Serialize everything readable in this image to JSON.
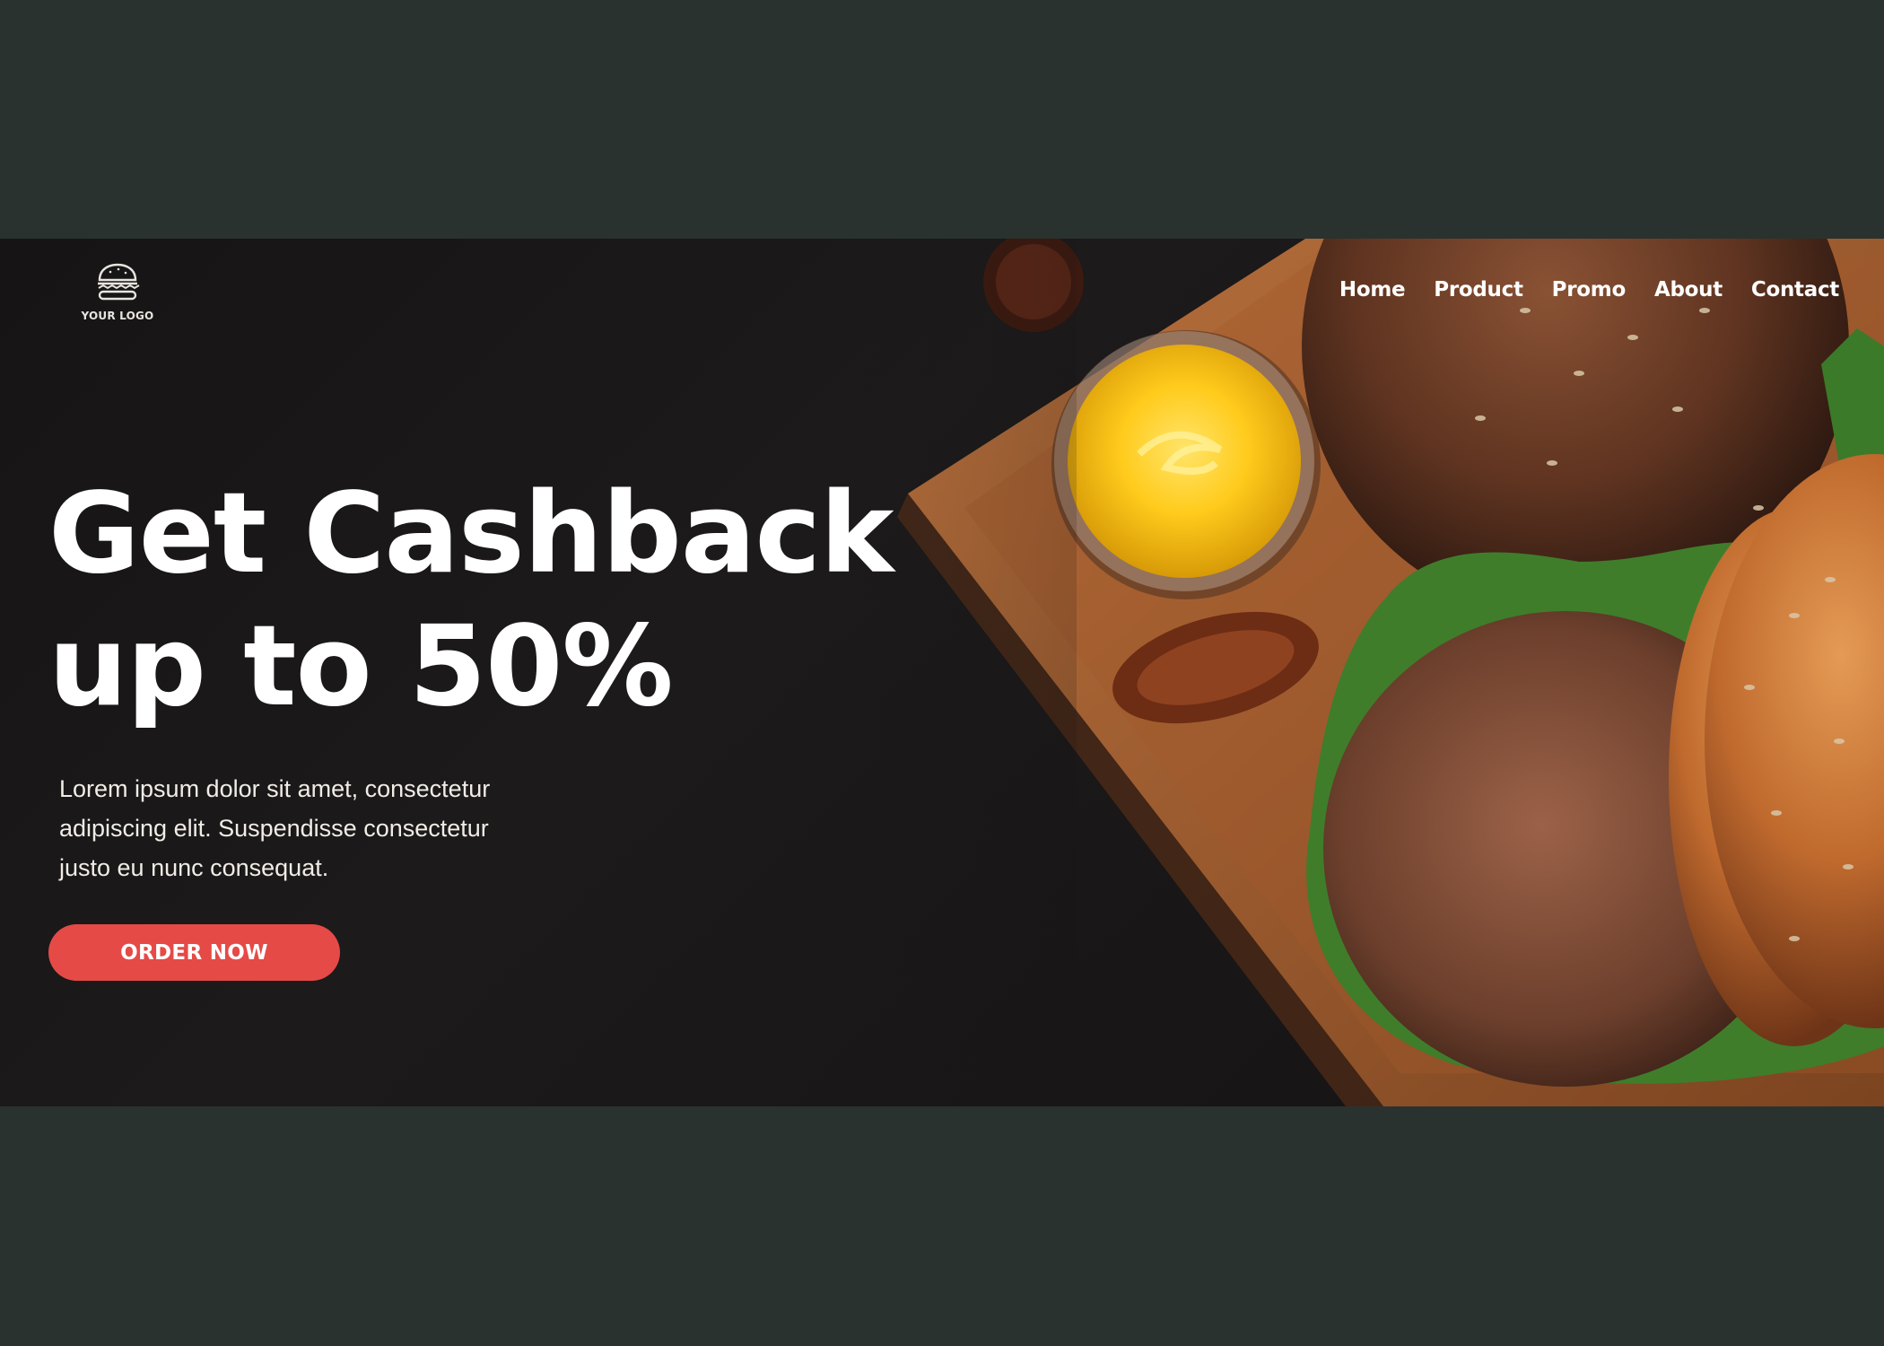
{
  "logo": {
    "text": "YOUR LOGO",
    "icon": "burger-icon"
  },
  "nav": {
    "items": [
      "Home",
      "Product",
      "Promo",
      "About",
      "Contact"
    ]
  },
  "hero": {
    "headline_line1": "Get Cashback",
    "headline_line2": "up to 50%",
    "description": "Lorem ipsum dolor sit amet, consectetur adipiscing elit. Suspendisse consectetur justo eu nunc consequat.",
    "cta_label": "ORDER NOW"
  },
  "colors": {
    "page_background": "#2a322f",
    "hero_background": "#161414",
    "accent": "#e54a47",
    "text": "#ffffff"
  }
}
